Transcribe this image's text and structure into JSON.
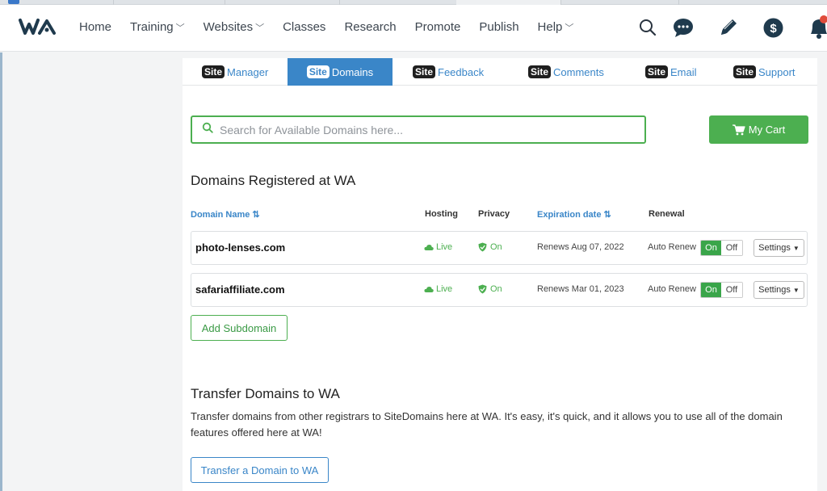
{
  "colors": {
    "accent_blue": "#3a86c8",
    "accent_green": "#4caf50",
    "toggle_on": "#3aa54a",
    "logo": "#1f3a4d"
  },
  "header": {
    "logo_text": "WA",
    "nav": [
      {
        "label": "Home",
        "dropdown": false
      },
      {
        "label": "Training",
        "dropdown": true
      },
      {
        "label": "Websites",
        "dropdown": true
      },
      {
        "label": "Classes",
        "dropdown": false
      },
      {
        "label": "Research",
        "dropdown": false
      },
      {
        "label": "Promote",
        "dropdown": false
      },
      {
        "label": "Publish",
        "dropdown": false
      },
      {
        "label": "Help",
        "dropdown": true
      }
    ],
    "icons": [
      "search-icon",
      "chat-icon",
      "pencil-icon",
      "dollar-icon",
      "bell-icon"
    ]
  },
  "tabs": [
    {
      "badge": "Site",
      "label": "Manager",
      "active": false
    },
    {
      "badge": "Site",
      "label": "Domains",
      "active": true
    },
    {
      "badge": "Site",
      "label": "Feedback",
      "active": false
    },
    {
      "badge": "Site",
      "label": "Comments",
      "active": false
    },
    {
      "badge": "Site",
      "label": "Email",
      "active": false
    },
    {
      "badge": "Site",
      "label": "Support",
      "active": false
    }
  ],
  "search": {
    "placeholder": "Search for Available Domains here...",
    "value": ""
  },
  "cart": {
    "label": "My Cart"
  },
  "registered": {
    "title": "Domains Registered at WA",
    "columns": {
      "domain_name": "Domain Name",
      "hosting": "Hosting",
      "privacy": "Privacy",
      "expiration": "Expiration date",
      "renewal": "Renewal"
    },
    "rows": [
      {
        "domain": "photo-lenses.com",
        "hosting": "Live",
        "privacy": "On",
        "expires": "Renews Aug 07, 2022",
        "renewal": "Auto Renew",
        "toggle_on": "On",
        "toggle_off": "Off",
        "settings": "Settings"
      },
      {
        "domain": "safariaffiliate.com",
        "hosting": "Live",
        "privacy": "On",
        "expires": "Renews Mar 01, 2023",
        "renewal": "Auto Renew",
        "toggle_on": "On",
        "toggle_off": "Off",
        "settings": "Settings"
      }
    ],
    "add_subdomain": "Add Subdomain"
  },
  "transfer": {
    "title": "Transfer Domains to WA",
    "description": "Transfer domains from other registrars to SiteDomains here at WA. It's easy, it's quick, and it allows you to use all of the domain features offered here at WA!",
    "button": "Transfer a Domain to WA"
  }
}
